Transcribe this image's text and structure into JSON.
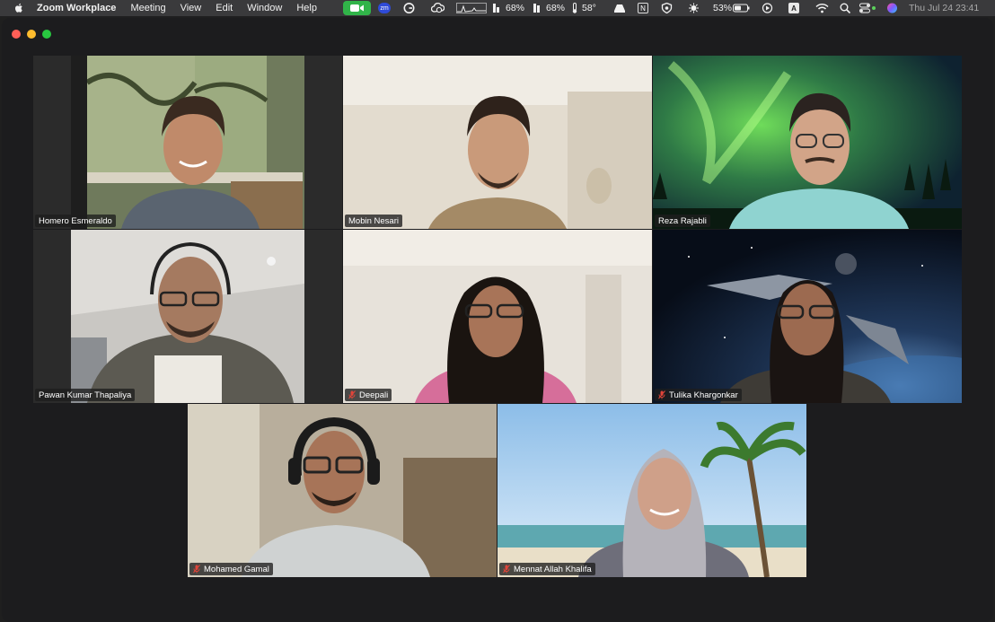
{
  "menubar": {
    "app_name": "Zoom Workplace",
    "menus": [
      "Meeting",
      "View",
      "Edit",
      "Window",
      "Help"
    ],
    "status": {
      "zm_badge": "zm",
      "cpu_percent": "68%",
      "memory_percent": "68%",
      "temperature": "58°",
      "notion_letter": "N",
      "battery_percent": "53%",
      "input_letter": "A",
      "datetime": "Thu Jul 24  23:41"
    }
  },
  "meeting": {
    "participants": [
      {
        "name": "Homero Esmeraldo",
        "muted": false,
        "active_speaker": false
      },
      {
        "name": "Mobin Nesari",
        "muted": false,
        "active_speaker": false
      },
      {
        "name": "Reza Rajabli",
        "muted": false,
        "active_speaker": false
      },
      {
        "name": "Pawan Kumar Thapaliya",
        "muted": false,
        "active_speaker": true
      },
      {
        "name": "Deepali",
        "muted": true,
        "active_speaker": false
      },
      {
        "name": "Tulika Khargonkar",
        "muted": true,
        "active_speaker": false
      },
      {
        "name": "Mohamed Gamal",
        "muted": true,
        "active_speaker": false
      },
      {
        "name": "Mennat Allah Khalifa",
        "muted": true,
        "active_speaker": false
      }
    ]
  },
  "colors": {
    "active_speaker_border": "#5cd35c",
    "muted_mic": "#e0453a",
    "zoom_status_green": "#31b449"
  }
}
